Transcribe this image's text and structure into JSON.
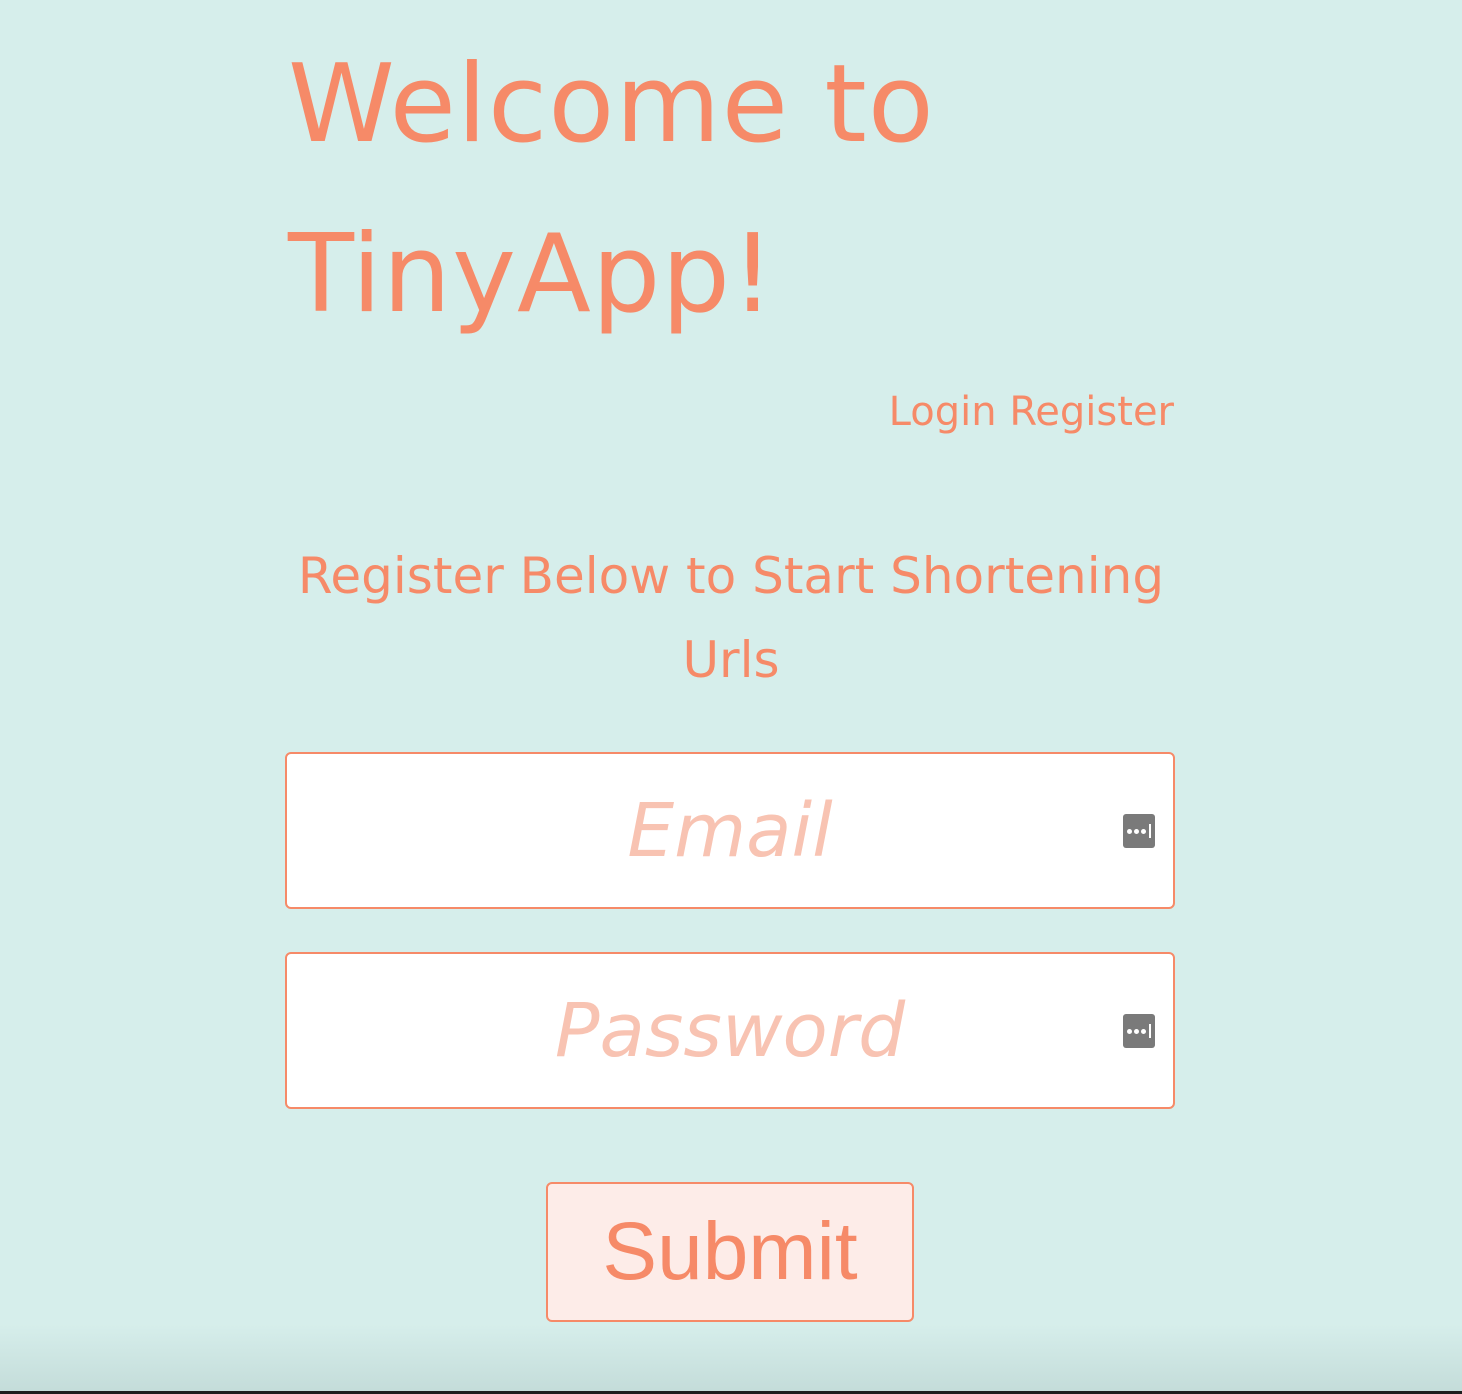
{
  "header": {
    "title": "Welcome to TinyApp!"
  },
  "nav": {
    "login_label": "Login",
    "register_label": "Register"
  },
  "form": {
    "heading": "Register Below to Start Shortening Urls",
    "email": {
      "value": "",
      "placeholder": "Email"
    },
    "password": {
      "value": "",
      "placeholder": "Password"
    },
    "submit_label": "Submit"
  },
  "icons": {
    "password_manager": "password-manager-icon"
  },
  "colors": {
    "background": "#d6eeeb",
    "accent": "#f68a68",
    "placeholder": "#f8c3b2",
    "button_bg": "#fdece8"
  }
}
